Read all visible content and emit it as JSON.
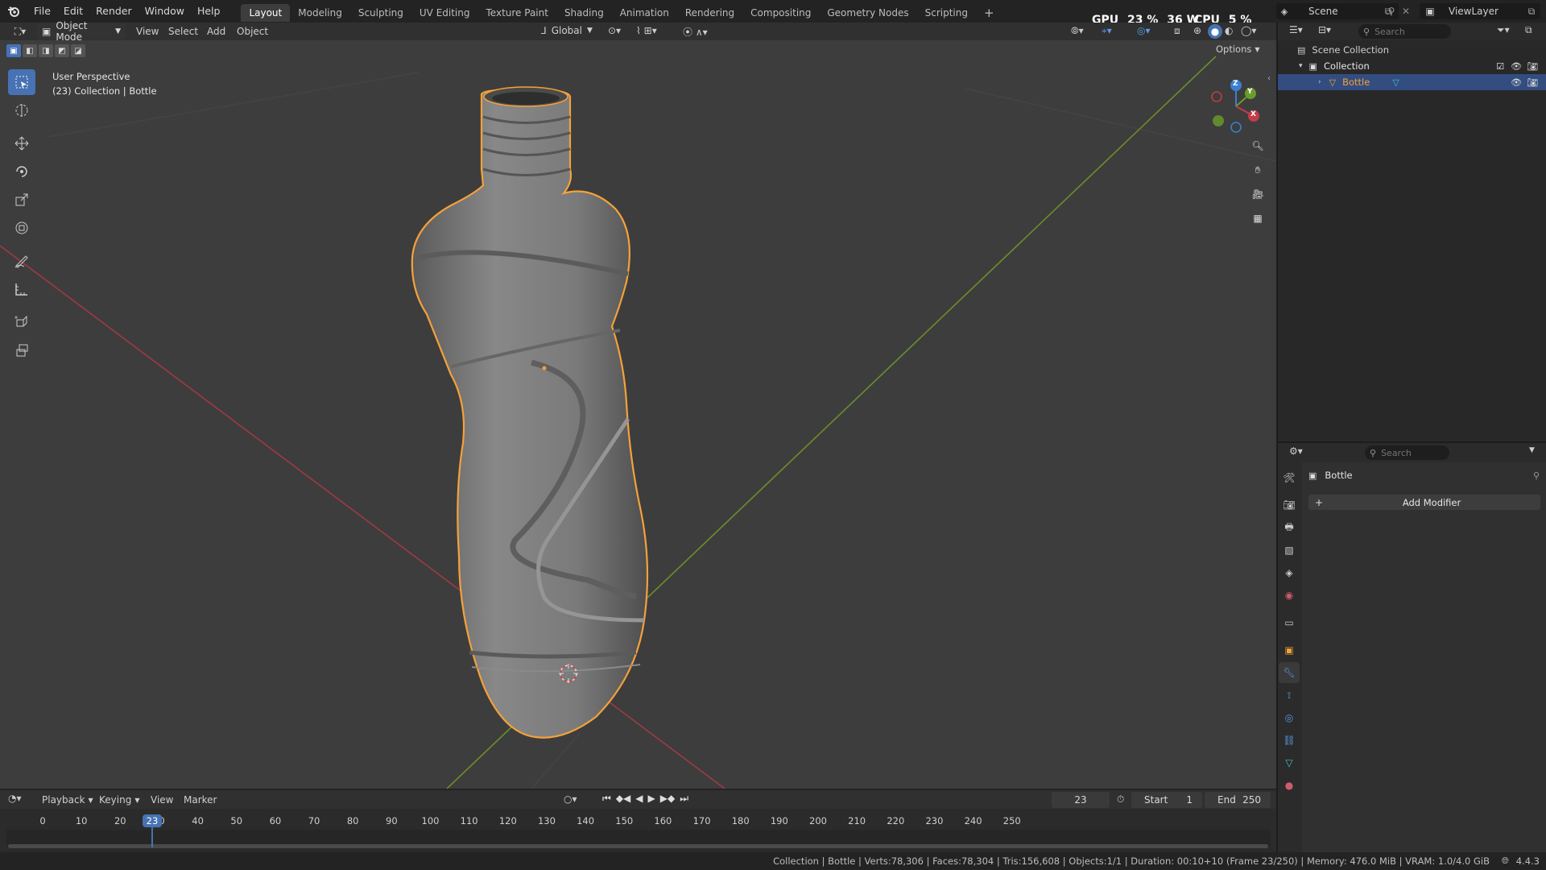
{
  "topbar": {
    "menus": [
      "File",
      "Edit",
      "Render",
      "Window",
      "Help"
    ],
    "workspaces": [
      "Layout",
      "Modeling",
      "Sculpting",
      "UV Editing",
      "Texture Paint",
      "Shading",
      "Animation",
      "Rendering",
      "Compositing",
      "Geometry Nodes",
      "Scripting"
    ],
    "active_workspace": "Layout",
    "add_workspace": "+",
    "gpu_label": "GPU",
    "gpu_value": "23 %",
    "gpu_watt": "36 W",
    "cpu_label": "CPU",
    "cpu_value": "5 %",
    "scene_name": "Scene",
    "view_layer": "ViewLayer"
  },
  "viewport_header": {
    "mode": "Object Mode",
    "menus": [
      "View",
      "Select",
      "Add",
      "Object"
    ],
    "transform_orientation": "Global",
    "options": "Options"
  },
  "viewport": {
    "overlay_line1": "User Perspective",
    "overlay_line2": "(23) Collection | Bottle",
    "gizmo_axes": {
      "x": "X",
      "y": "Y",
      "z": "Z"
    },
    "colors": {
      "bg": "#3d3d3d",
      "x_axis": "#9e3a45",
      "y_axis": "#6a8e2a",
      "selection_outline": "#f5a13a"
    }
  },
  "outliner": {
    "search_placeholder": "Search",
    "scene_collection": "Scene Collection",
    "collection": "Collection",
    "object": "Bottle"
  },
  "properties": {
    "search_placeholder": "Search",
    "object_name": "Bottle",
    "add_modifier": "Add Modifier"
  },
  "timeline": {
    "menus": [
      "Playback",
      "Keying",
      "View",
      "Marker"
    ],
    "current_frame": "23",
    "start_label": "Start",
    "start_value": "1",
    "end_label": "End",
    "end_value": "250",
    "ticks": [
      "0",
      "10",
      "20",
      "30",
      "40",
      "50",
      "60",
      "70",
      "80",
      "90",
      "100",
      "110",
      "120",
      "130",
      "140",
      "150",
      "160",
      "170",
      "180",
      "190",
      "200",
      "210",
      "220",
      "230",
      "240",
      "250"
    ],
    "playhead": "23"
  },
  "statusbar": {
    "text": "Collection | Bottle | Verts:78,306 | Faces:78,304 | Tris:156,608 | Objects:1/1 | Duration: 00:10+10 (Frame 23/250) | Memory: 476.0 MiB | VRAM: 1.0/4.0 GiB",
    "version": "4.4.3"
  }
}
